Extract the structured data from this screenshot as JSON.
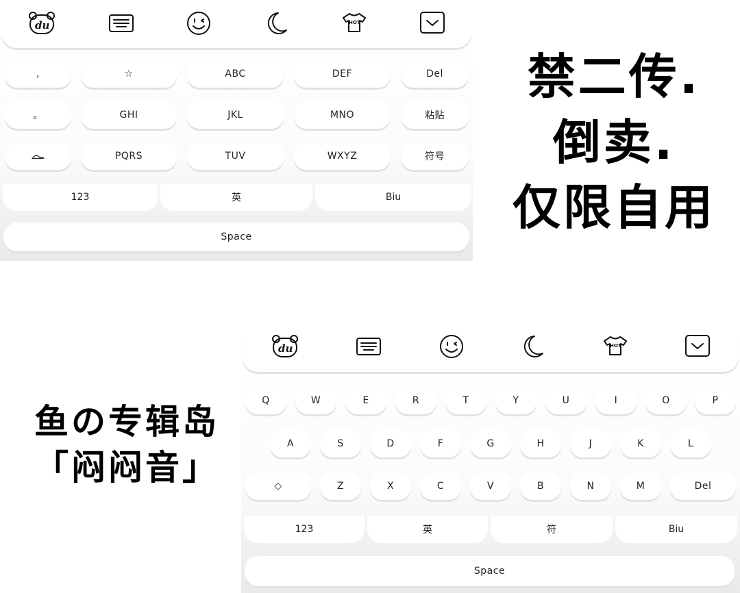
{
  "caption_top": {
    "line1": "禁二传.",
    "line2": "倒卖.",
    "line3": "仅限自用"
  },
  "caption_bottom": {
    "line1": "鱼の专辑岛",
    "line2": "「闷闷音」"
  },
  "toolbar": {
    "icons": [
      "bear-logo-icon",
      "keyboard-icon",
      "emoji-icon",
      "moon-icon",
      "hot-shirt-icon",
      "collapse-chevron-icon"
    ],
    "logo_text": "du",
    "hot_text": "HOT"
  },
  "keyboard_t9": {
    "row1": [
      ",",
      "☆",
      "ABC",
      "DEF",
      "Del"
    ],
    "row2": [
      "。",
      "GHI",
      "JKL",
      "MNO",
      "粘贴"
    ],
    "row3": [
      "",
      "PQRS",
      "TUV",
      "WXYZ",
      "符号"
    ],
    "row4": [
      "123",
      "英",
      "Biu"
    ],
    "space": "Space"
  },
  "keyboard_qwerty": {
    "row1": [
      "Q",
      "W",
      "E",
      "R",
      "T",
      "Y",
      "U",
      "I",
      "O",
      "P"
    ],
    "row2": [
      "A",
      "S",
      "D",
      "F",
      "G",
      "H",
      "J",
      "K",
      "L"
    ],
    "row3": [
      "◇",
      "Z",
      "X",
      "C",
      "V",
      "B",
      "N",
      "M",
      "Del"
    ],
    "row4": [
      "123",
      "英",
      "符",
      "Biu"
    ],
    "space": "Space"
  }
}
